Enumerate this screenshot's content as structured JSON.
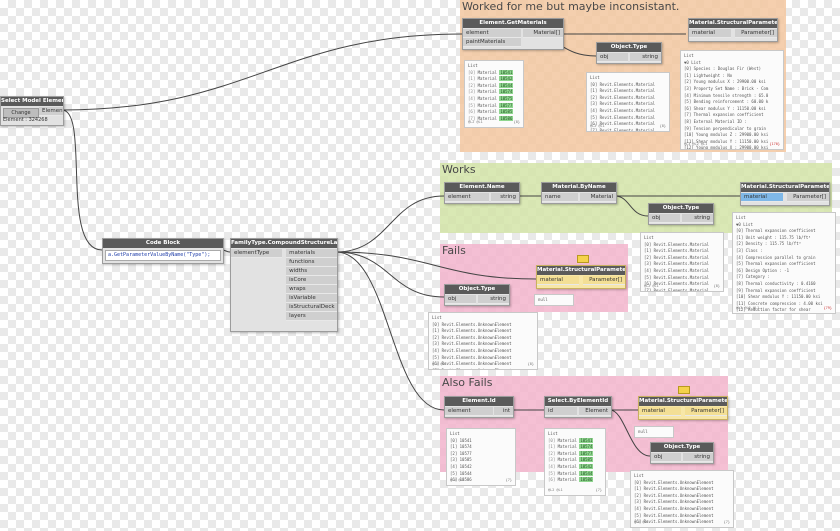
{
  "groups": {
    "worked": {
      "title": "Worked for me but maybe inconsistant.",
      "color": "#f3c7a0"
    },
    "works": {
      "title": "Works",
      "color": "#d3e4a8"
    },
    "fails": {
      "title": "Fails",
      "color": "#f3b5cd"
    },
    "also_fails": {
      "title": "Also Fails",
      "color": "#f3b5cd"
    }
  },
  "select_model": {
    "title": "Select Model Element",
    "change_label": "Change",
    "output_label": "Element",
    "element_text": "Element : 324268"
  },
  "code_block": {
    "title": "Code Block",
    "code": "a.GetParameterValueByName(\"Type\");",
    "out": ">"
  },
  "family_type": {
    "title": "FamilyType.CompoundStructureLayers",
    "input": "elementType",
    "outputs": [
      "materials",
      "functions",
      "widths",
      "isCore",
      "wraps",
      "isVariable",
      "isStructuralDeck",
      "layers"
    ]
  },
  "el_get_materials": {
    "title": "Element.GetMaterials",
    "inputs": [
      "element",
      "paintMaterials"
    ],
    "output": "Material[]",
    "preview_head": "List",
    "preview_items": [
      {
        "idx": "[0]",
        "name": "Material",
        "val": "10541"
      },
      {
        "idx": "[1]",
        "name": "Material",
        "val": "10542"
      },
      {
        "idx": "[2]",
        "name": "Material",
        "val": "10544"
      },
      {
        "idx": "[3]",
        "name": "Material",
        "val": "10574"
      },
      {
        "idx": "[4]",
        "name": "Material",
        "val": "10575"
      },
      {
        "idx": "[5]",
        "name": "Material",
        "val": "10577"
      },
      {
        "idx": "[6]",
        "name": "Material",
        "val": "10585"
      },
      {
        "idx": "[7]",
        "name": "Material",
        "val": "10586"
      }
    ],
    "foot_left": "@L2 @L1",
    "foot_right": "{8}"
  },
  "obj_type_1": {
    "title": "Object.Type",
    "input": "obj",
    "output": "string",
    "preview_head": "List",
    "preview_items": [
      "[0] Revit.Elements.Material",
      "[1] Revit.Elements.Material",
      "[2] Revit.Elements.Material",
      "[3] Revit.Elements.Material",
      "[4] Revit.Elements.Material",
      "[5] Revit.Elements.Material",
      "[6] Revit.Elements.Material",
      "[7] Revit.Elements.Material"
    ],
    "foot_left": "@L2 @L1",
    "foot_right": "{8}"
  },
  "mat_struct_1": {
    "title": "Material.StructuralParameters",
    "input": "material",
    "output": "Parameter[]",
    "preview_head": "List",
    "preview_items": [
      "▼0 List",
      "  [0] Species : Douglas Fir (West)",
      "  [1] Lightweight : No",
      "  [2] Young modulus X : 29900.00 ksi",
      "  [3] Property Set Name : Brick - Com",
      "  [4] Minimum tensile strength : 65.0",
      "  [5] Bending reinforcement : 60.00 k",
      "  [6] Shear modulus Y : 11150.00 ksi",
      "  [7] Thermal expansion coefficient",
      "  [8] External Material ID :",
      "  [9] Tension perpendicular to grain",
      "  [10] Young modulus Z : 29900.00 ksi",
      "  [11] Shear modulus Y : 11150.00 ksi",
      "  [12] Young modulus X : 29900.00 ksi",
      "  [13] Subclass :"
    ],
    "foot_left": "@L3 @L2 @L1",
    "foot_right": "{170}"
  },
  "el_name": {
    "title": "Element.Name",
    "input": "element",
    "output": "string"
  },
  "mat_byname": {
    "title": "Material.ByName",
    "input": "name",
    "output": "Material"
  },
  "obj_type_2": {
    "title": "Object.Type",
    "input": "obj",
    "output": "string",
    "preview_head": "List",
    "preview_items": [
      "[0] Revit.Elements.Material",
      "[1] Revit.Elements.Material",
      "[2] Revit.Elements.Material",
      "[3] Revit.Elements.Material",
      "[4] Revit.Elements.Material",
      "[5] Revit.Elements.Material",
      "[6] Revit.Elements.Material",
      "[7] Revit.Elements.Material"
    ],
    "foot_left": "@L2 @L1",
    "foot_right": "{8}"
  },
  "mat_struct_2": {
    "title": "Material.StructuralParameters",
    "input": "material",
    "output": "Parameter[]",
    "preview_head": "List",
    "preview_items": [
      "▼0 List",
      "  [0] Thermal expansion coefficient",
      "  [1] Unit weight : 115.75 lb/ft³",
      "  [2] Density : 115.75 lb/ft³",
      "  [3] Class :",
      "  [4] Compression parallel to grain",
      "  [5] Thermal expansion coefficient",
      "  [6] Design Option : -1",
      "  [7] Category :",
      "  [8] Thermal conductivity : 0.4160",
      "  [9] Thermal expansion coefficient",
      "  [10] Shear modulus Y : 11150.00 ksi",
      "  [11] Concrete compression : 4.00 ksi",
      "  [12] Reduction factor for shear",
      "  [13] Shear modulus X : 11150.00 ksi"
    ],
    "foot_left": "@L3 @L2 @L1",
    "foot_right": "{79}"
  },
  "mat_struct_fail": {
    "title": "Material.StructuralParameters",
    "input": "material",
    "output": "Parameter[]",
    "preview_head": "null"
  },
  "obj_type_fail": {
    "title": "Object.Type",
    "input": "obj",
    "output": "string",
    "preview_head": "List",
    "preview_items": [
      "[0] Revit.Elements.UnknownElement",
      "[1] Revit.Elements.UnknownElement",
      "[2] Revit.Elements.UnknownElement",
      "[3] Revit.Elements.UnknownElement",
      "[4] Revit.Elements.UnknownElement",
      "[5] Revit.Elements.UnknownElement",
      "[6] Revit.Elements.UnknownElement",
      "[7] Revit.Elements.UnknownElement"
    ],
    "foot_left": "@L2 @L1",
    "foot_right": "{8}"
  },
  "el_id": {
    "title": "Element.Id",
    "input": "element",
    "output": "int",
    "preview_head": "List",
    "preview_items": [
      "[0] 10541",
      "[1] 10574",
      "[2] 10577",
      "[3] 10585",
      "[4] 10542",
      "[5] 10544",
      "[6] 10586"
    ],
    "foot_left": "@L2 @L1",
    "foot_right": "{7}"
  },
  "select_by_id": {
    "title": "Select.ByElementId",
    "input": "id",
    "output": "Element",
    "preview_head": "List",
    "preview_items": [
      {
        "idx": "[0]",
        "name": "Material",
        "val": "10541"
      },
      {
        "idx": "[1]",
        "name": "Material",
        "val": "10574"
      },
      {
        "idx": "[2]",
        "name": "Material",
        "val": "10577"
      },
      {
        "idx": "[3]",
        "name": "Material",
        "val": "10585"
      },
      {
        "idx": "[4]",
        "name": "Material",
        "val": "10542"
      },
      {
        "idx": "[5]",
        "name": "Material",
        "val": "10544"
      },
      {
        "idx": "[6]",
        "name": "Material",
        "val": "10586"
      }
    ],
    "foot_left": "@L2 @L1",
    "foot_right": "{7}"
  },
  "mat_struct_3": {
    "title": "Material.StructuralParameters",
    "input": "material",
    "output": "Parameter[]",
    "preview_head": "null"
  },
  "obj_type_3": {
    "title": "Object.Type",
    "input": "obj",
    "output": "string",
    "preview_head": "List",
    "preview_items": [
      "[0] Revit.Elements.UnknownElement",
      "[1] Revit.Elements.UnknownElement",
      "[2] Revit.Elements.UnknownElement",
      "[3] Revit.Elements.UnknownElement",
      "[4] Revit.Elements.UnknownElement",
      "[5] Revit.Elements.UnknownElement",
      "[6] Revit.Elements.UnknownElement"
    ],
    "foot_left": "@L2 @L1",
    "foot_right": "{7}"
  }
}
